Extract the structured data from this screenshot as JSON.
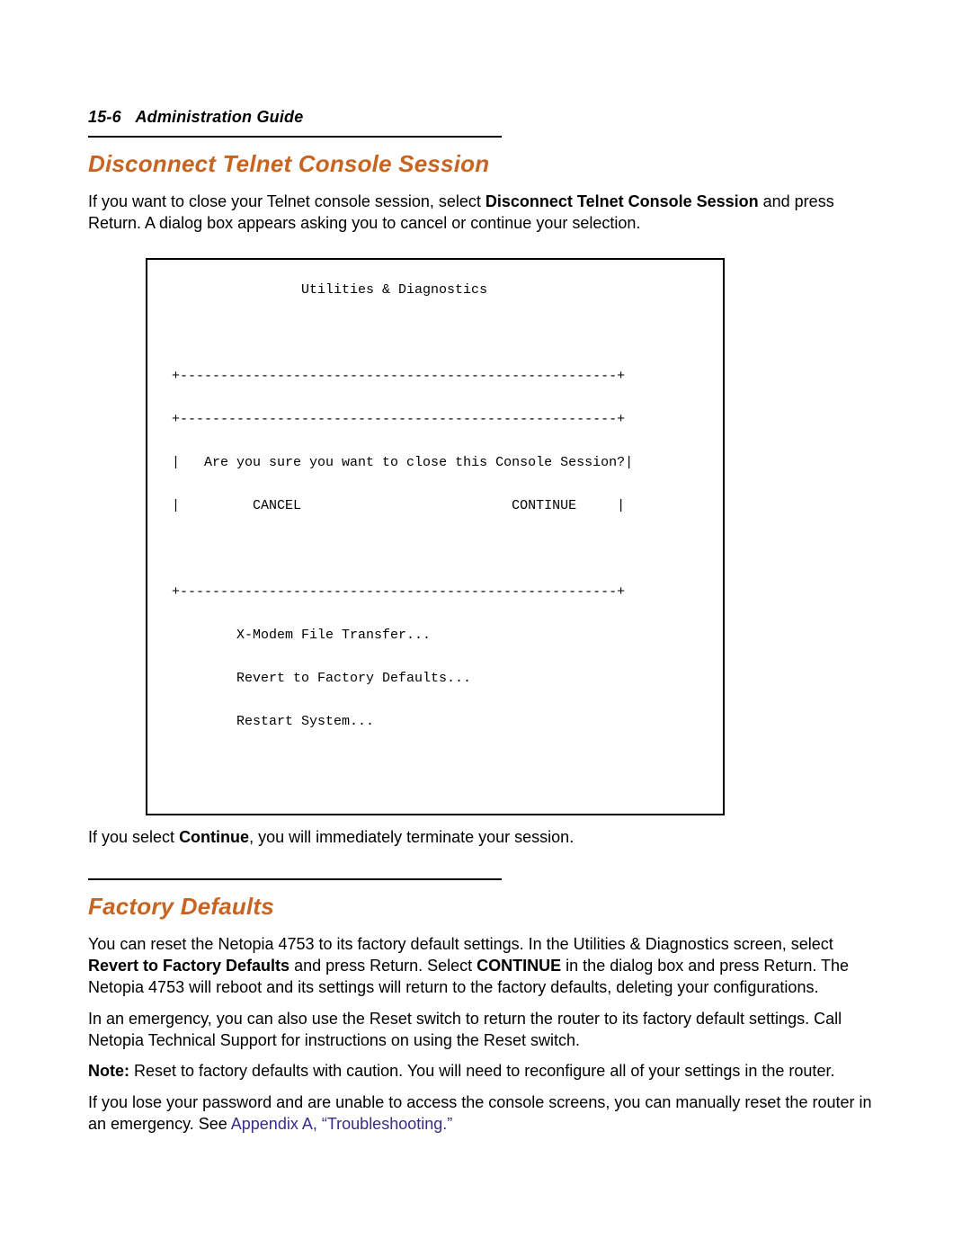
{
  "header": {
    "page_ref": "15-6",
    "title": "Administration Guide"
  },
  "section1": {
    "heading": "Disconnect Telnet Console Session",
    "para1_pre": "If you want to close your Telnet console session, select ",
    "para1_bold": "Disconnect Telnet Console Session",
    "para1_post": " and press Return. A dialog box appears asking you to cancel or continue your selection.",
    "para2_pre": "If you select ",
    "para2_bold": "Continue",
    "para2_post": ", you will immediately terminate your session."
  },
  "terminal": {
    "title": "Utilities & Diagnostics",
    "border_top": " +------------------------------------------------------+",
    "border_top2": " +------------------------------------------------------+",
    "border_side_l": " |",
    "border_side_r": "|",
    "prompt_pre": "   Are you sure you want to close this Console Session?",
    "cancel": "         CANCEL",
    "gap_mid": "                          ",
    "continue": "CONTINUE",
    "cont_tail": "     ",
    "border_bot": " +------------------------------------------------------+",
    "menu1": "         X-Modem File Transfer...",
    "menu2": "         Revert to Factory Defaults...",
    "menu3": "         Restart System..."
  },
  "section2": {
    "heading": "Factory Defaults",
    "para1_a": "You can reset the Netopia 4753 to its factory default settings. In the Utilities & Diagnostics screen, select ",
    "para1_b": "Revert to Factory Defaults",
    "para1_c": " and press Return. Select ",
    "para1_d": "CONTINUE",
    "para1_e": " in the dialog box and press Return. The Netopia 4753 will reboot and its settings will return to the factory defaults, deleting your configurations.",
    "para2": "In an emergency, you can also use the Reset switch to return the router to its factory default settings. Call Netopia Technical Support for instructions on using the Reset switch.",
    "para3_a": "Note:",
    "para3_b": " Reset to factory defaults with caution. You will need to reconfigure all of your settings in the router.",
    "para4_a": "If you lose your password and are unable to access the console screens, you can manually reset the router in an emergency. See ",
    "para4_link": "Appendix A, “Troubleshooting.”"
  }
}
